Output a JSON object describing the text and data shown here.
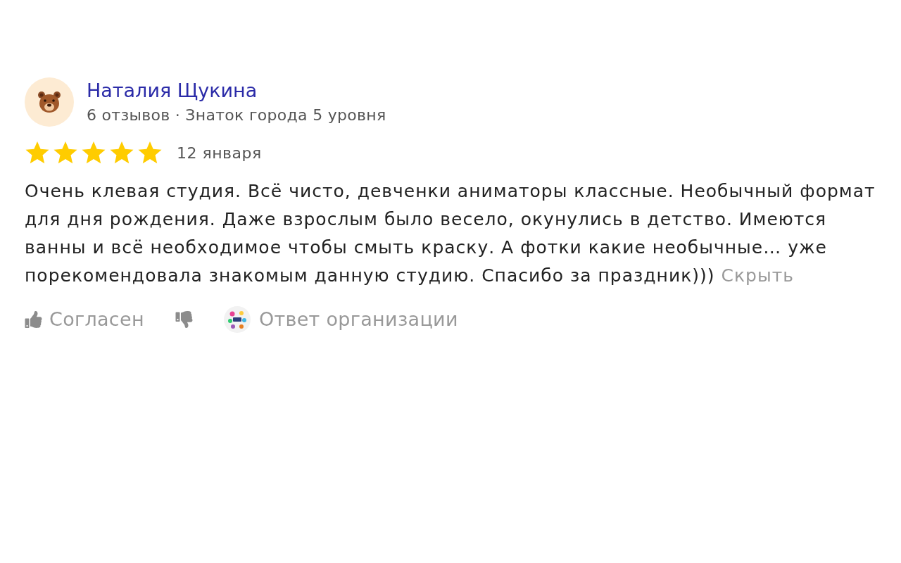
{
  "review": {
    "author": {
      "name": "Наталия Щукина",
      "meta": "6 отзывов · Знаток города 5 уровня"
    },
    "stars": 5,
    "date": "12 января",
    "text": "Очень клевая студия. Всё чисто, девченки аниматоры классные. Необычный формат для дня рождения. Даже взрослым было весело, окунулись в детство. Имеются ванны и всё необходимое чтобы смыть краску. А фотки какие необычные… уже порекомендовала знакомым данную студию. Спасибо за праздник)))",
    "hide_link": "Скрыть",
    "actions": [
      {
        "kind": "like",
        "label": "Согласен"
      },
      {
        "kind": "dislike"
      },
      {
        "kind": "org_reply",
        "label": "Ответ организации"
      }
    ]
  }
}
